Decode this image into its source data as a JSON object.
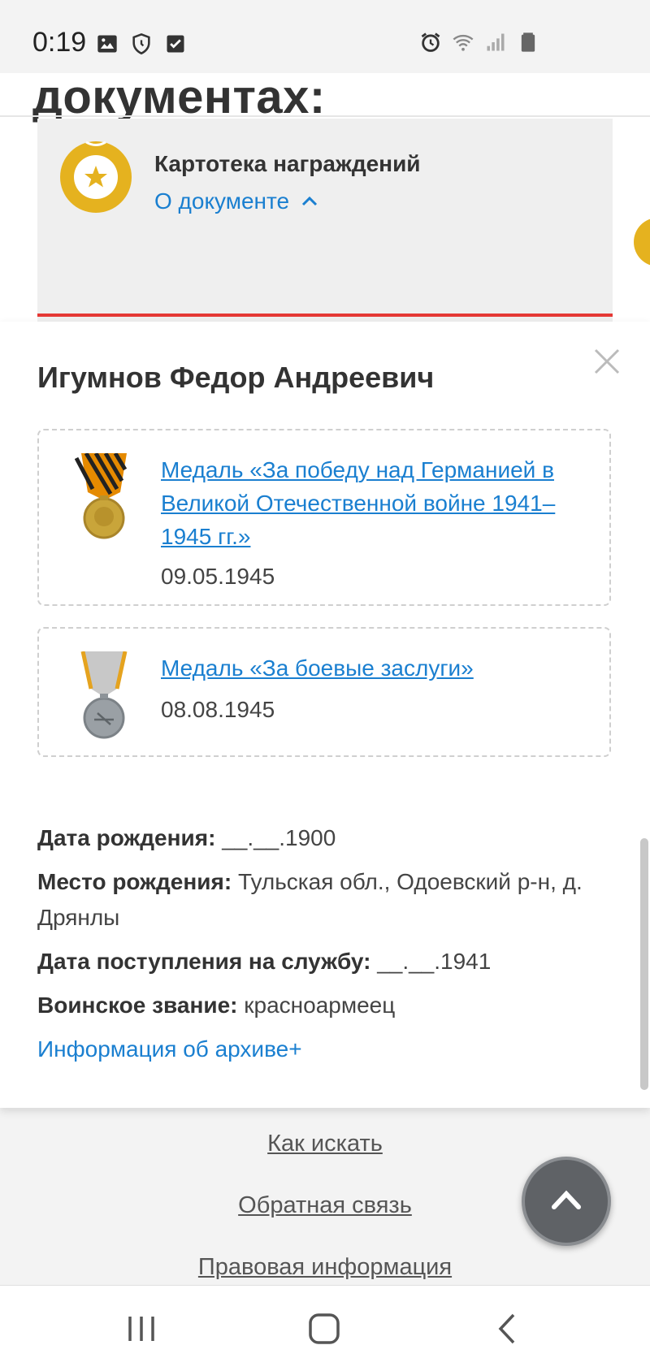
{
  "status_bar": {
    "time": "0:19",
    "icons_left": [
      "image-icon",
      "shield-icon",
      "checkbox-icon"
    ],
    "icons_right": [
      "alarm-icon",
      "wifi-icon",
      "signal-icon",
      "battery-icon"
    ]
  },
  "section": {
    "heading": "документах:"
  },
  "doc_card": {
    "icon": "medal-star-icon",
    "title": "Картотека награждений",
    "about_label": "О документе",
    "accent_color": "#e53935",
    "medal_color": "#e5b21f"
  },
  "person": {
    "name": "Игумнов Федор Андреевич",
    "awards": [
      {
        "title": "Медаль «За победу над Германией в Великой Отечественной войне 1941–1945 гг.»",
        "date": "09.05.1945",
        "icon": "victory-medal-icon"
      },
      {
        "title": "Медаль «За боевые заслуги»",
        "date": "08.08.1945",
        "icon": "combat-merit-medal-icon"
      }
    ],
    "birth_date_label": "Дата рождения:",
    "birth_date_value": "__.__.1900",
    "birth_place_label": "Место рождения:",
    "birth_place_value": "Тульская обл., Одоевский р-н, д. Дрянлы",
    "service_date_label": "Дата поступления на службу:",
    "service_date_value": "__.__.1941",
    "rank_label": "Воинское звание:",
    "rank_value": "красноармеец",
    "archive_link": "Информация об архиве+"
  },
  "footer": {
    "links": [
      "Как искать",
      "Обратная связь",
      "Правовая информация"
    ]
  },
  "colors": {
    "link": "#1a7fd0",
    "text": "#333333",
    "background": "#f3f3f3"
  }
}
